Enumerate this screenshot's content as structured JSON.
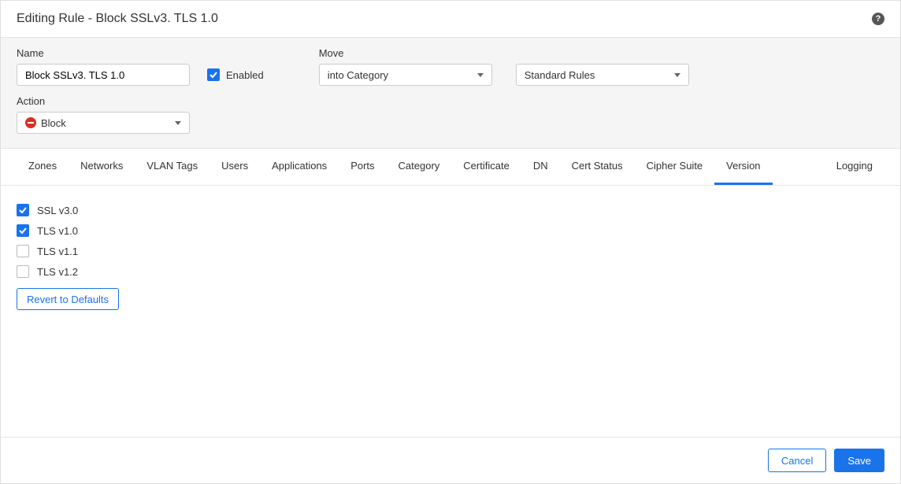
{
  "header": {
    "title": "Editing Rule - Block SSLv3. TLS 1.0"
  },
  "form": {
    "name_label": "Name",
    "name_value": "Block SSLv3. TLS 1.0",
    "enabled_label": "Enabled",
    "enabled_checked": true,
    "move_label": "Move",
    "move_value": "into Category",
    "std_value": "Standard Rules",
    "action_label": "Action",
    "action_value": "Block"
  },
  "tabs": [
    {
      "id": "zones",
      "label": "Zones",
      "active": false
    },
    {
      "id": "networks",
      "label": "Networks",
      "active": false
    },
    {
      "id": "vlan",
      "label": "VLAN Tags",
      "active": false
    },
    {
      "id": "users",
      "label": "Users",
      "active": false
    },
    {
      "id": "apps",
      "label": "Applications",
      "active": false
    },
    {
      "id": "ports",
      "label": "Ports",
      "active": false
    },
    {
      "id": "category",
      "label": "Category",
      "active": false
    },
    {
      "id": "cert",
      "label": "Certificate",
      "active": false
    },
    {
      "id": "dn",
      "label": "DN",
      "active": false
    },
    {
      "id": "certstatus",
      "label": "Cert Status",
      "active": false
    },
    {
      "id": "cipher",
      "label": "Cipher Suite",
      "active": false
    },
    {
      "id": "version",
      "label": "Version",
      "active": true
    },
    {
      "id": "logging",
      "label": "Logging",
      "active": false,
      "right": true
    }
  ],
  "versions": [
    {
      "label": "SSL v3.0",
      "checked": true
    },
    {
      "label": "TLS v1.0",
      "checked": true
    },
    {
      "label": "TLS v1.1",
      "checked": false
    },
    {
      "label": "TLS v1.2",
      "checked": false
    }
  ],
  "revert_label": "Revert to Defaults",
  "footer": {
    "cancel": "Cancel",
    "save": "Save"
  }
}
